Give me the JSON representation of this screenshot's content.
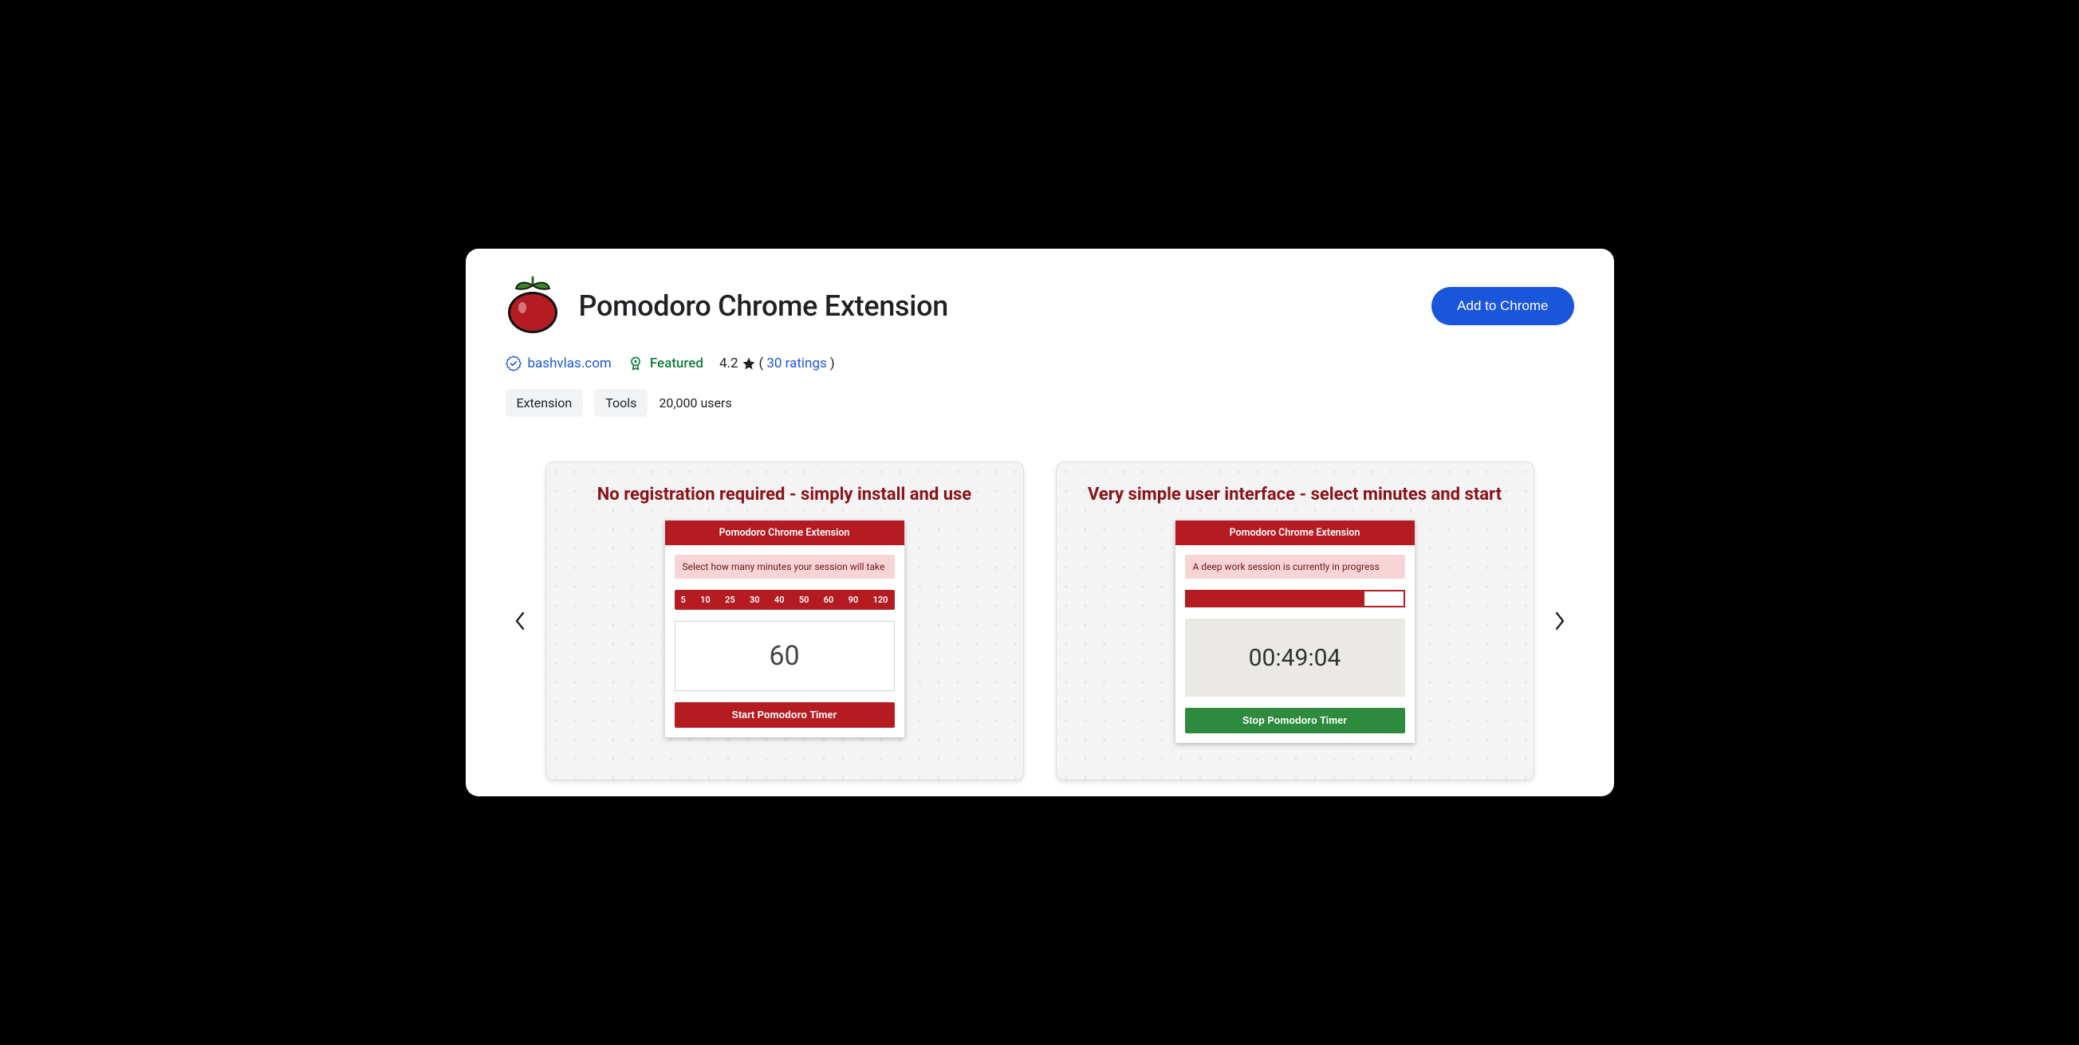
{
  "header": {
    "title": "Pomodoro Chrome Extension",
    "add_button": "Add to Chrome"
  },
  "meta": {
    "verified_site": "bashvlas.com",
    "featured_label": "Featured",
    "rating_value": "4.2",
    "ratings_count_label": "30 ratings"
  },
  "tags": {
    "type_chip": "Extension",
    "category_chip": "Tools",
    "users_label": "20,000 users"
  },
  "carousel": {
    "slides": [
      {
        "title": "No registration required - simply install and use",
        "panel_header": "Pomodoro Chrome Extension",
        "message": "Select how many minutes your session will take",
        "minute_options": [
          "5",
          "10",
          "25",
          "30",
          "40",
          "50",
          "60",
          "90",
          "120"
        ],
        "big_value": "60",
        "action_label": "Start Pomodoro Timer"
      },
      {
        "title": "Very simple user interface - select minutes and start",
        "panel_header": "Pomodoro Chrome Extension",
        "message": "A deep work session is currently in progress",
        "timer_value": "00:49:04",
        "action_label": "Stop Pomodoro Timer"
      }
    ]
  }
}
